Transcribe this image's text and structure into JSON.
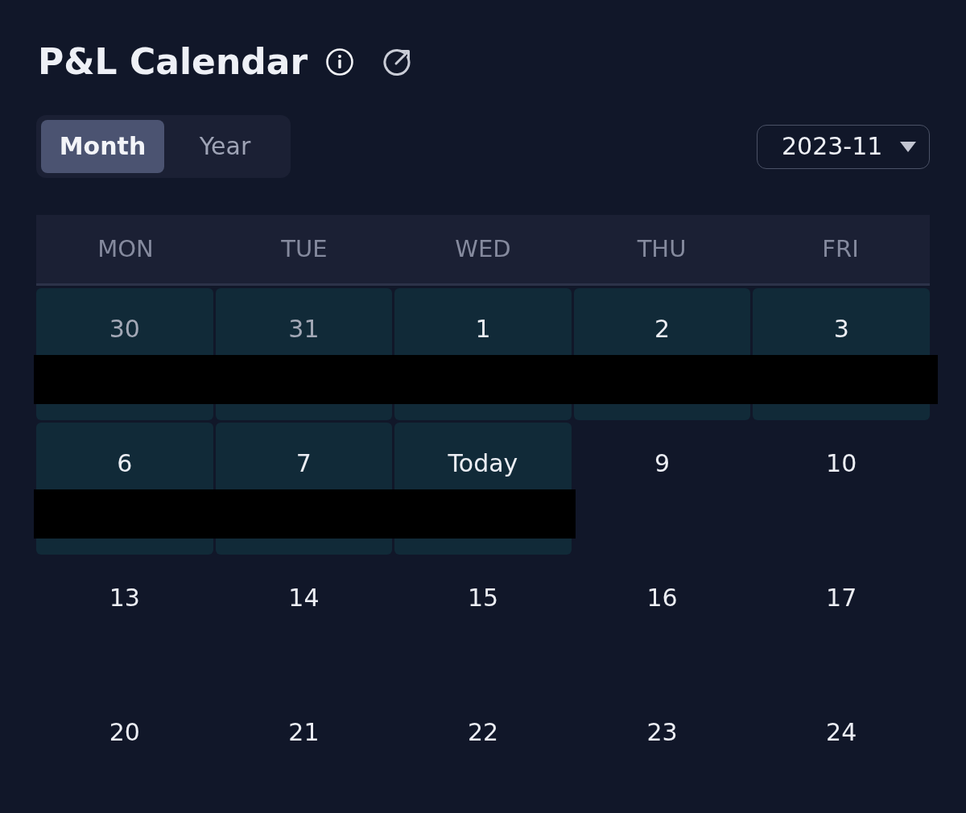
{
  "title": "P&L Calendar",
  "tabs": [
    {
      "label": "Month",
      "selected": true
    },
    {
      "label": "Year",
      "selected": false
    }
  ],
  "month_picker": {
    "value": "2023-11"
  },
  "weekdays": [
    "MON",
    "TUE",
    "WED",
    "THU",
    "FRI"
  ],
  "weeks": [
    {
      "days": [
        {
          "label": "30",
          "in_month": false,
          "highlighted": true,
          "redacted": true
        },
        {
          "label": "31",
          "in_month": false,
          "highlighted": true,
          "redacted": true
        },
        {
          "label": "1",
          "in_month": true,
          "highlighted": true,
          "redacted": true
        },
        {
          "label": "2",
          "in_month": true,
          "highlighted": true,
          "redacted": true
        },
        {
          "label": "3",
          "in_month": true,
          "highlighted": true,
          "redacted": true
        }
      ]
    },
    {
      "days": [
        {
          "label": "6",
          "in_month": true,
          "highlighted": true,
          "redacted": true
        },
        {
          "label": "7",
          "in_month": true,
          "highlighted": true,
          "redacted": true
        },
        {
          "label": "Today",
          "in_month": true,
          "highlighted": true,
          "redacted": true
        },
        {
          "label": "9",
          "in_month": true,
          "highlighted": false,
          "redacted": false
        },
        {
          "label": "10",
          "in_month": true,
          "highlighted": false,
          "redacted": false
        }
      ]
    },
    {
      "days": [
        {
          "label": "13",
          "in_month": true,
          "highlighted": false,
          "redacted": false
        },
        {
          "label": "14",
          "in_month": true,
          "highlighted": false,
          "redacted": false
        },
        {
          "label": "15",
          "in_month": true,
          "highlighted": false,
          "redacted": false
        },
        {
          "label": "16",
          "in_month": true,
          "highlighted": false,
          "redacted": false
        },
        {
          "label": "17",
          "in_month": true,
          "highlighted": false,
          "redacted": false
        }
      ]
    },
    {
      "days": [
        {
          "label": "20",
          "in_month": true,
          "highlighted": false,
          "redacted": false
        },
        {
          "label": "21",
          "in_month": true,
          "highlighted": false,
          "redacted": false
        },
        {
          "label": "22",
          "in_month": true,
          "highlighted": false,
          "redacted": false
        },
        {
          "label": "23",
          "in_month": true,
          "highlighted": false,
          "redacted": false
        },
        {
          "label": "24",
          "in_month": true,
          "highlighted": false,
          "redacted": false
        }
      ]
    }
  ]
}
